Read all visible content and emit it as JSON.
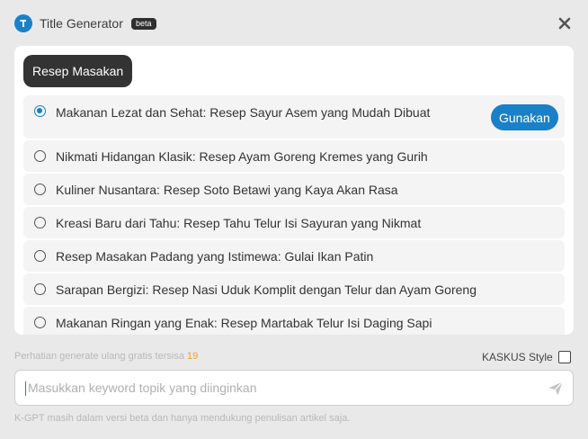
{
  "header": {
    "title": "Title Generator",
    "badge": "beta",
    "logo_icon": "k-logo-icon",
    "close_icon": "close-icon"
  },
  "results": {
    "keyword_chip": "Resep Masakan",
    "use_button_label": "Gunakan",
    "selected_index": 0,
    "options": [
      "Makanan Lezat dan Sehat: Resep Sayur Asem yang Mudah Dibuat",
      "Nikmati Hidangan Klasik: Resep Ayam Goreng Kremes yang Gurih",
      "Kuliner Nusantara: Resep Soto Betawi yang Kaya Akan Rasa",
      "Kreasi Baru dari Tahu: Resep Tahu Telur Isi Sayuran yang Nikmat",
      "Resep Masakan Padang yang Istimewa: Gulai Ikan Patin",
      "Sarapan Bergizi: Resep Nasi Uduk Komplit dengan Telur dan Ayam Goreng",
      "Makanan Ringan yang Enak: Resep Martabak Telur Isi Daging Sapi"
    ]
  },
  "quota": {
    "label": "Perhatian generate ulang gratis tersisa",
    "remaining": "19"
  },
  "style_option": {
    "label": "KASKUS Style",
    "checked": false
  },
  "input": {
    "placeholder": "Masukkan keyword topik yang diinginkan",
    "value": "",
    "send_icon": "send-icon"
  },
  "footer": {
    "note": "K-GPT masih dalam versi beta dan hanya mendukung penulisan artikel saja."
  },
  "colors": {
    "accent": "#1a80c8",
    "background": "#e9e9e9",
    "chip": "#333333",
    "quota_number": "#f0a020"
  }
}
